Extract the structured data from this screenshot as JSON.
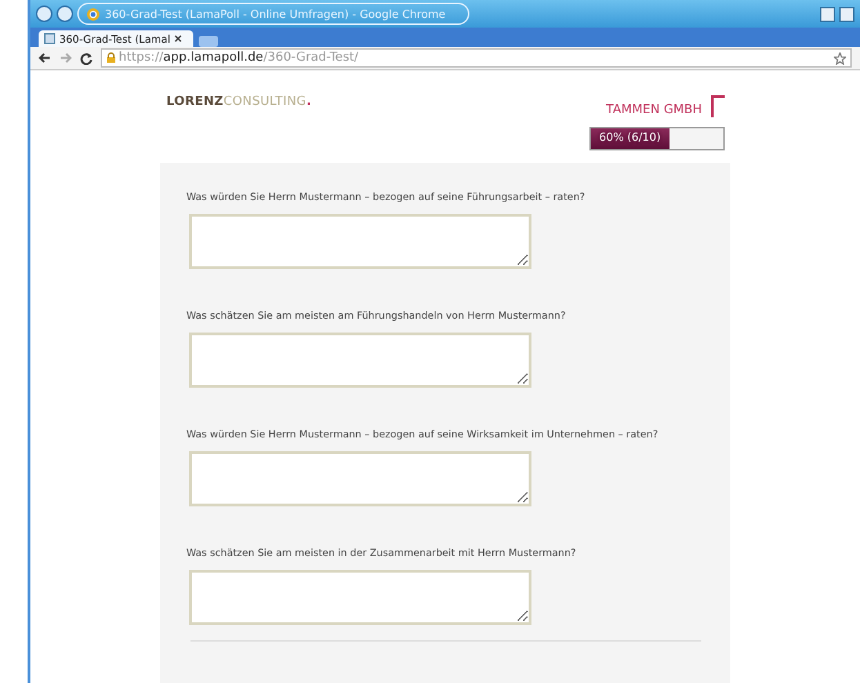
{
  "window": {
    "title": "360-Grad-Test (LamaPoll - Online Umfragen) - Google Chrome"
  },
  "tabs": [
    {
      "label": "360-Grad-Test (Lamal",
      "selected": true
    }
  ],
  "address_bar": {
    "scheme": "https://",
    "host": "app.lamapoll.de",
    "path": "/360-Grad-Test/"
  },
  "header": {
    "logo_bold": "LORENZ",
    "logo_light": "CONSULTING",
    "logo_dot": ".",
    "company": "TAMMEN GMBH"
  },
  "progress": {
    "level": 0.6,
    "label": "60% (6/10)"
  },
  "questions": [
    {
      "text": "Was würden Sie Herrn Mustermann – bezogen auf seine Führungsarbeit – raten?"
    },
    {
      "text": "Was schätzen Sie am meisten am Führungshandeln von Herrn Mustermann?"
    },
    {
      "text": "Was würden Sie Herrn Mustermann – bezogen auf seine Wirksamkeit im Unternehmen – raten?"
    },
    {
      "text": "Was schätzen Sie am meisten in der Zusammenarbeit mit Herrn Mustermann?"
    }
  ]
}
